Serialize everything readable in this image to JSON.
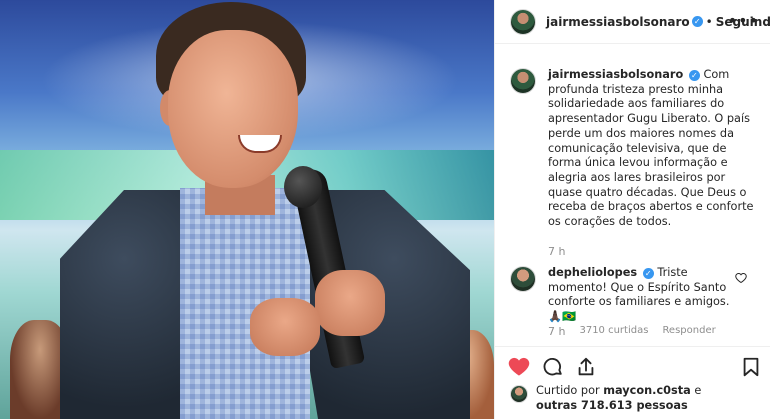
{
  "post": {
    "author": "jairmessiasbolsonaro",
    "follow_state": "Seguindo",
    "separator": "•",
    "verified_mark": "✓",
    "more_icon": "more-horizontal-icon",
    "caption": "Com profunda tristeza presto minha solidariedade aos familiares do apresentador Gugu Liberato. O país perde um dos maiores nomes da comunicação televisiva, que de forma única levou informação e alegria aos lares brasileiros por quase quatro décadas. Que Deus o receba de braços abertos e conforte os corações de todos.",
    "caption_time": "7 h"
  },
  "comment": {
    "author": "dephelio​lopes",
    "text": "Triste momento! Que o Espírito Santo conforte os familiares e amigos. 🙏🏿🇧🇷",
    "time": "7 h",
    "likes": "3710 curtidas",
    "reply_label": "Responder"
  },
  "actions": {
    "like_icon": "heart-filled-icon",
    "comment_icon": "comment-icon",
    "share_icon": "share-icon",
    "save_icon": "bookmark-icon",
    "like_color": "#ed4956"
  },
  "likes_summary": {
    "prefix": "Curtido por ",
    "user": "maycon.c0sta",
    "middle": " e ",
    "others": "outras 718.613 pessoas"
  }
}
